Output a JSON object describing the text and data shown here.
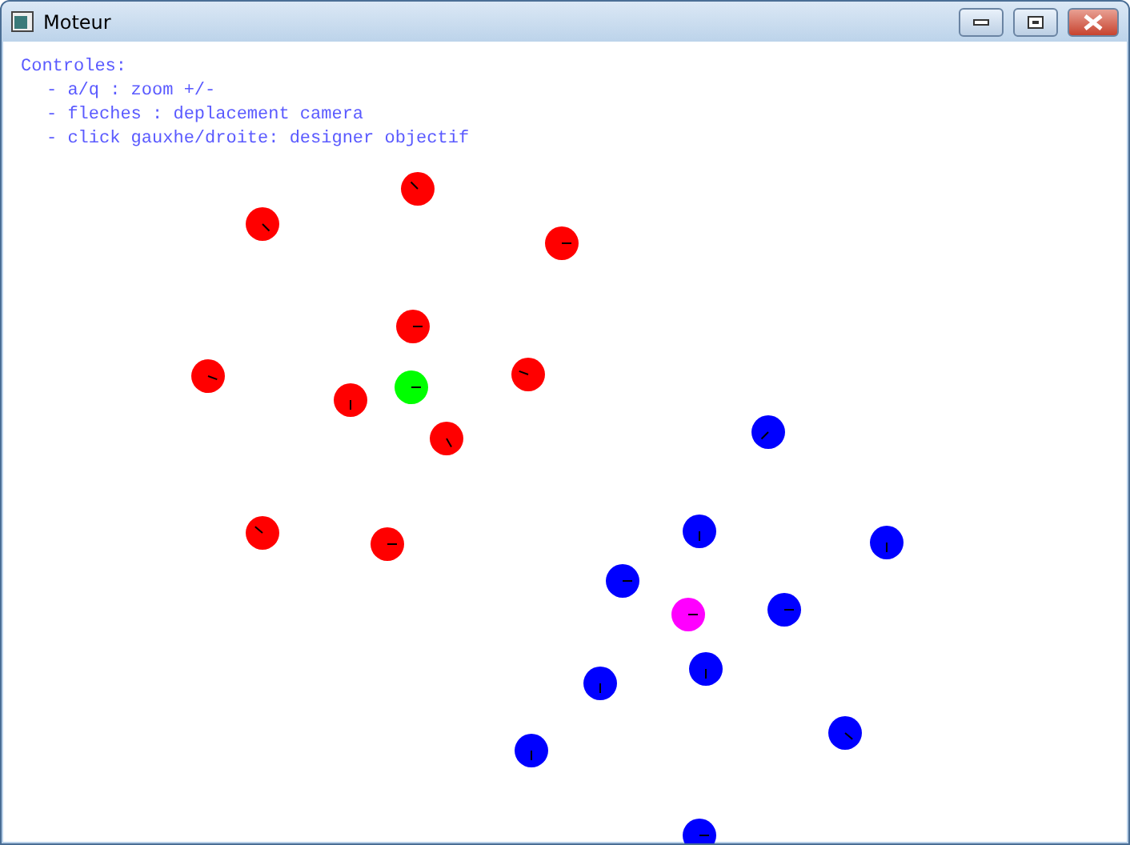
{
  "window": {
    "title": "Moteur"
  },
  "help": {
    "heading": "Controles:",
    "lines": [
      "- a/q : zoom +/-",
      "- fleches : deplacement camera",
      "- click gauxhe/droite: designer objectif"
    ]
  },
  "units": [
    {
      "color": "#ff0000"
    },
    {
      "color": "#ff0000"
    },
    {
      "color": "#ff0000"
    },
    {
      "color": "#ff0000"
    },
    {
      "color": "#ff0000"
    },
    {
      "color": "#ff0000"
    },
    {
      "color": "#ff0000"
    },
    {
      "color": "#ff0000"
    },
    {
      "color": "#ff0000"
    },
    {
      "color": "#ff0000"
    },
    {
      "color": "#00ff00"
    },
    {
      "color": "#0000ff"
    },
    {
      "color": "#0000ff"
    },
    {
      "color": "#0000ff"
    },
    {
      "color": "#0000ff"
    },
    {
      "color": "#0000ff"
    },
    {
      "color": "#0000ff"
    },
    {
      "color": "#0000ff"
    },
    {
      "color": "#0000ff"
    },
    {
      "color": "#0000ff"
    },
    {
      "color": "#0000ff"
    },
    {
      "color": "#ff00ff"
    }
  ]
}
